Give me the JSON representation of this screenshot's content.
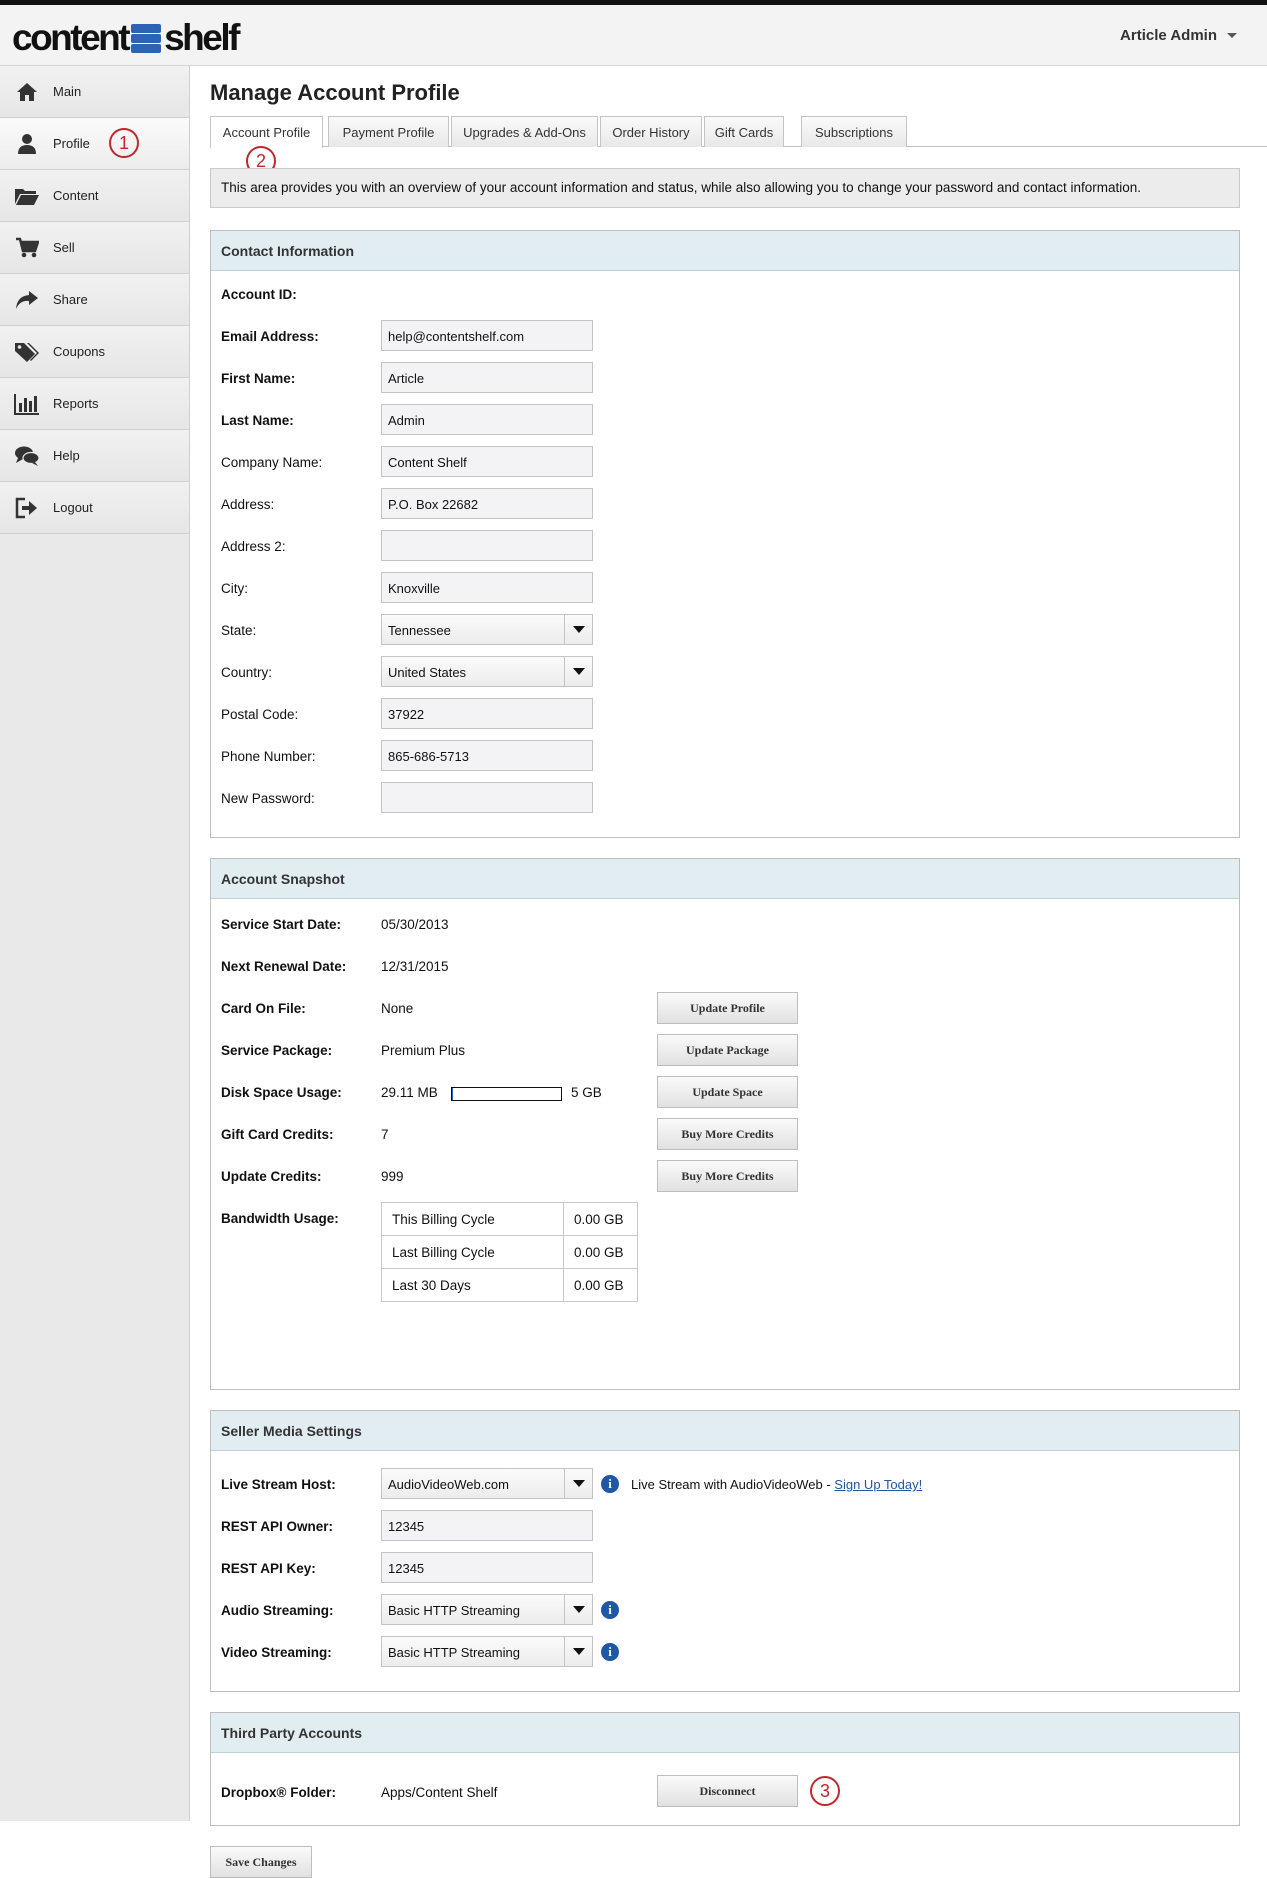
{
  "header": {
    "logo_part1": "content",
    "logo_part2": "shelf",
    "user_name": "Article Admin"
  },
  "sidebar": {
    "items": [
      {
        "label": "Main",
        "icon": "home-icon"
      },
      {
        "label": "Profile",
        "icon": "user-icon"
      },
      {
        "label": "Content",
        "icon": "folder-icon"
      },
      {
        "label": "Sell",
        "icon": "cart-icon"
      },
      {
        "label": "Share",
        "icon": "share-icon"
      },
      {
        "label": "Coupons",
        "icon": "tags-icon"
      },
      {
        "label": "Reports",
        "icon": "bar-chart-icon"
      },
      {
        "label": "Help",
        "icon": "chat-icon"
      },
      {
        "label": "Logout",
        "icon": "logout-icon"
      }
    ]
  },
  "markers": {
    "m1": "1",
    "m2": "2",
    "m3": "3",
    "color": "#c0272d"
  },
  "page": {
    "title": "Manage Account Profile",
    "tabs": [
      "Account Profile",
      "Payment Profile",
      "Upgrades & Add-Ons",
      "Order History",
      "Gift Cards",
      "Subscriptions"
    ],
    "notice": "This area provides you with an overview of your account information and status, while also allowing you to change your password and contact information."
  },
  "contact": {
    "title": "Contact Information",
    "account_id_label": "Account ID:",
    "email_label": "Email Address:",
    "email": "help@contentshelf.com",
    "first_label": "First Name:",
    "first": "Article",
    "last_label": "Last Name:",
    "last": "Admin",
    "company_label": "Company Name:",
    "company": "Content Shelf",
    "address_label": "Address:",
    "address": "P.O. Box 22682",
    "address2_label": "Address 2:",
    "address2": "",
    "city_label": "City:",
    "city": "Knoxville",
    "state_label": "State:",
    "state": "Tennessee",
    "country_label": "Country:",
    "country": "United States",
    "postal_label": "Postal Code:",
    "postal": "37922",
    "phone_label": "Phone Number:",
    "phone": "865-686-5713",
    "password_label": "New Password:",
    "password": ""
  },
  "snapshot": {
    "title": "Account Snapshot",
    "start_label": "Service Start Date:",
    "start": "05/30/2013",
    "renewal_label": "Next Renewal Date:",
    "renewal": "12/31/2015",
    "card_label": "Card On File:",
    "card": "None",
    "package_label": "Service Package:",
    "package": "Premium Plus",
    "disk_label": "Disk Space Usage:",
    "disk_used": "29.11 MB",
    "disk_total": "5 GB",
    "disk_fraction": 0.006,
    "gift_label": "Gift Card Credits:",
    "gift": "7",
    "update_label": "Update Credits:",
    "update": "999",
    "bandwidth_label": "Bandwidth Usage:",
    "bandwidth": [
      {
        "period": "This Billing Cycle",
        "value": "0.00 GB"
      },
      {
        "period": "Last Billing Cycle",
        "value": "0.00 GB"
      },
      {
        "period": "Last 30 Days",
        "value": "0.00 GB"
      }
    ],
    "btn_update_profile": "Update Profile",
    "btn_update_package": "Update Package",
    "btn_update_space": "Update Space",
    "btn_buy_credits": "Buy More Credits",
    "btn_buy_credits2": "Buy More Credits"
  },
  "media": {
    "title": "Seller Media Settings",
    "host_label": "Live Stream Host:",
    "host": "AudioVideoWeb.com",
    "host_note": "Live Stream with AudioVideoWeb - ",
    "host_link": "Sign Up Today!",
    "owner_label": "REST API Owner:",
    "owner": "12345",
    "key_label": "REST API Key:",
    "key": "12345",
    "audio_label": "Audio Streaming:",
    "audio": "Basic HTTP Streaming",
    "video_label": "Video Streaming:",
    "video": "Basic HTTP Streaming",
    "info_glyph": "i"
  },
  "third_party": {
    "title": "Third Party Accounts",
    "dropbox_label": "Dropbox® Folder:",
    "dropbox": "Apps/Content Shelf",
    "disconnect": "Disconnect"
  },
  "save_label": "Save Changes"
}
